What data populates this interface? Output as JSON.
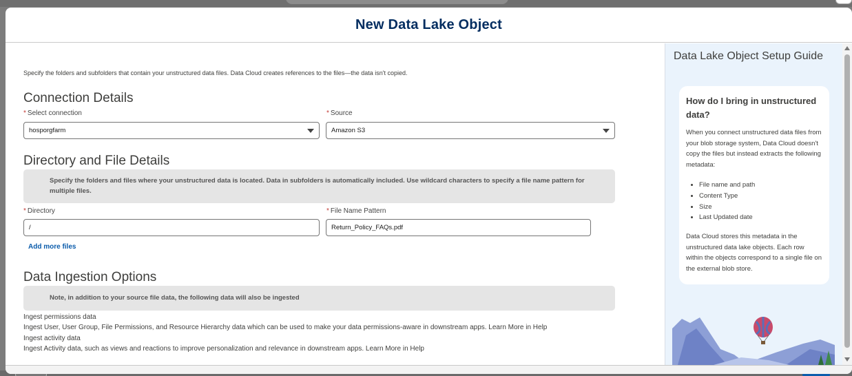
{
  "modal": {
    "title": "New Data Lake Object"
  },
  "intro": "Specify the folders and subfolders that contain your unstructured data files. Data Cloud creates references to the files—the data isn't copied.",
  "connection": {
    "title": "Connection Details",
    "select_connection_label": "Select connection",
    "select_connection_value": "hosporgfarm",
    "source_label": "Source",
    "source_value": "Amazon S3"
  },
  "directory": {
    "title": "Directory and File Details",
    "note": "Specify the folders and files where your unstructured data is located. Data in subfolders is automatically included. Use wildcard characters to specify a file name pattern for multiple files.",
    "directory_label": "Directory",
    "directory_value": "/",
    "file_pattern_label": "File Name Pattern",
    "file_pattern_value": "Return_Policy_FAQs.pdf",
    "add_more_label": "Add more files"
  },
  "ingestion": {
    "title": "Data Ingestion Options",
    "note": "Note, in addition to your source file data, the following data will also be ingested",
    "permissions_title": "Ingest permissions data",
    "permissions_desc": "Ingest User, User Group, File Permissions, and Resource Hierarchy data which can be used to make your data permissions-aware in downstream apps. Learn More in Help",
    "activity_title": "Ingest activity data",
    "activity_desc": "Ingest Activity data, such as views and reactions to improve personalization and relevance in downstream apps. Learn More in Help"
  },
  "guide": {
    "title": "Data Lake Object Setup Guide",
    "question": "How do I bring in unstructured data?",
    "para1": "When you connect unstructured data files from your blob storage system, Data Cloud doesn't copy the files but instead extracts the following metadata:",
    "items": [
      "File name and path",
      "Content Type",
      "Size",
      "Last Updated date"
    ],
    "para2": "Data Cloud stores this metadata in the unstructured data lake objects. Each row within the objects correspond to a single file on the external blob store."
  },
  "colors": {
    "title_blue": "#032d60",
    "link_blue": "#0b5cab",
    "required_red": "#c23934",
    "guide_bg": "#eaf3fc"
  }
}
